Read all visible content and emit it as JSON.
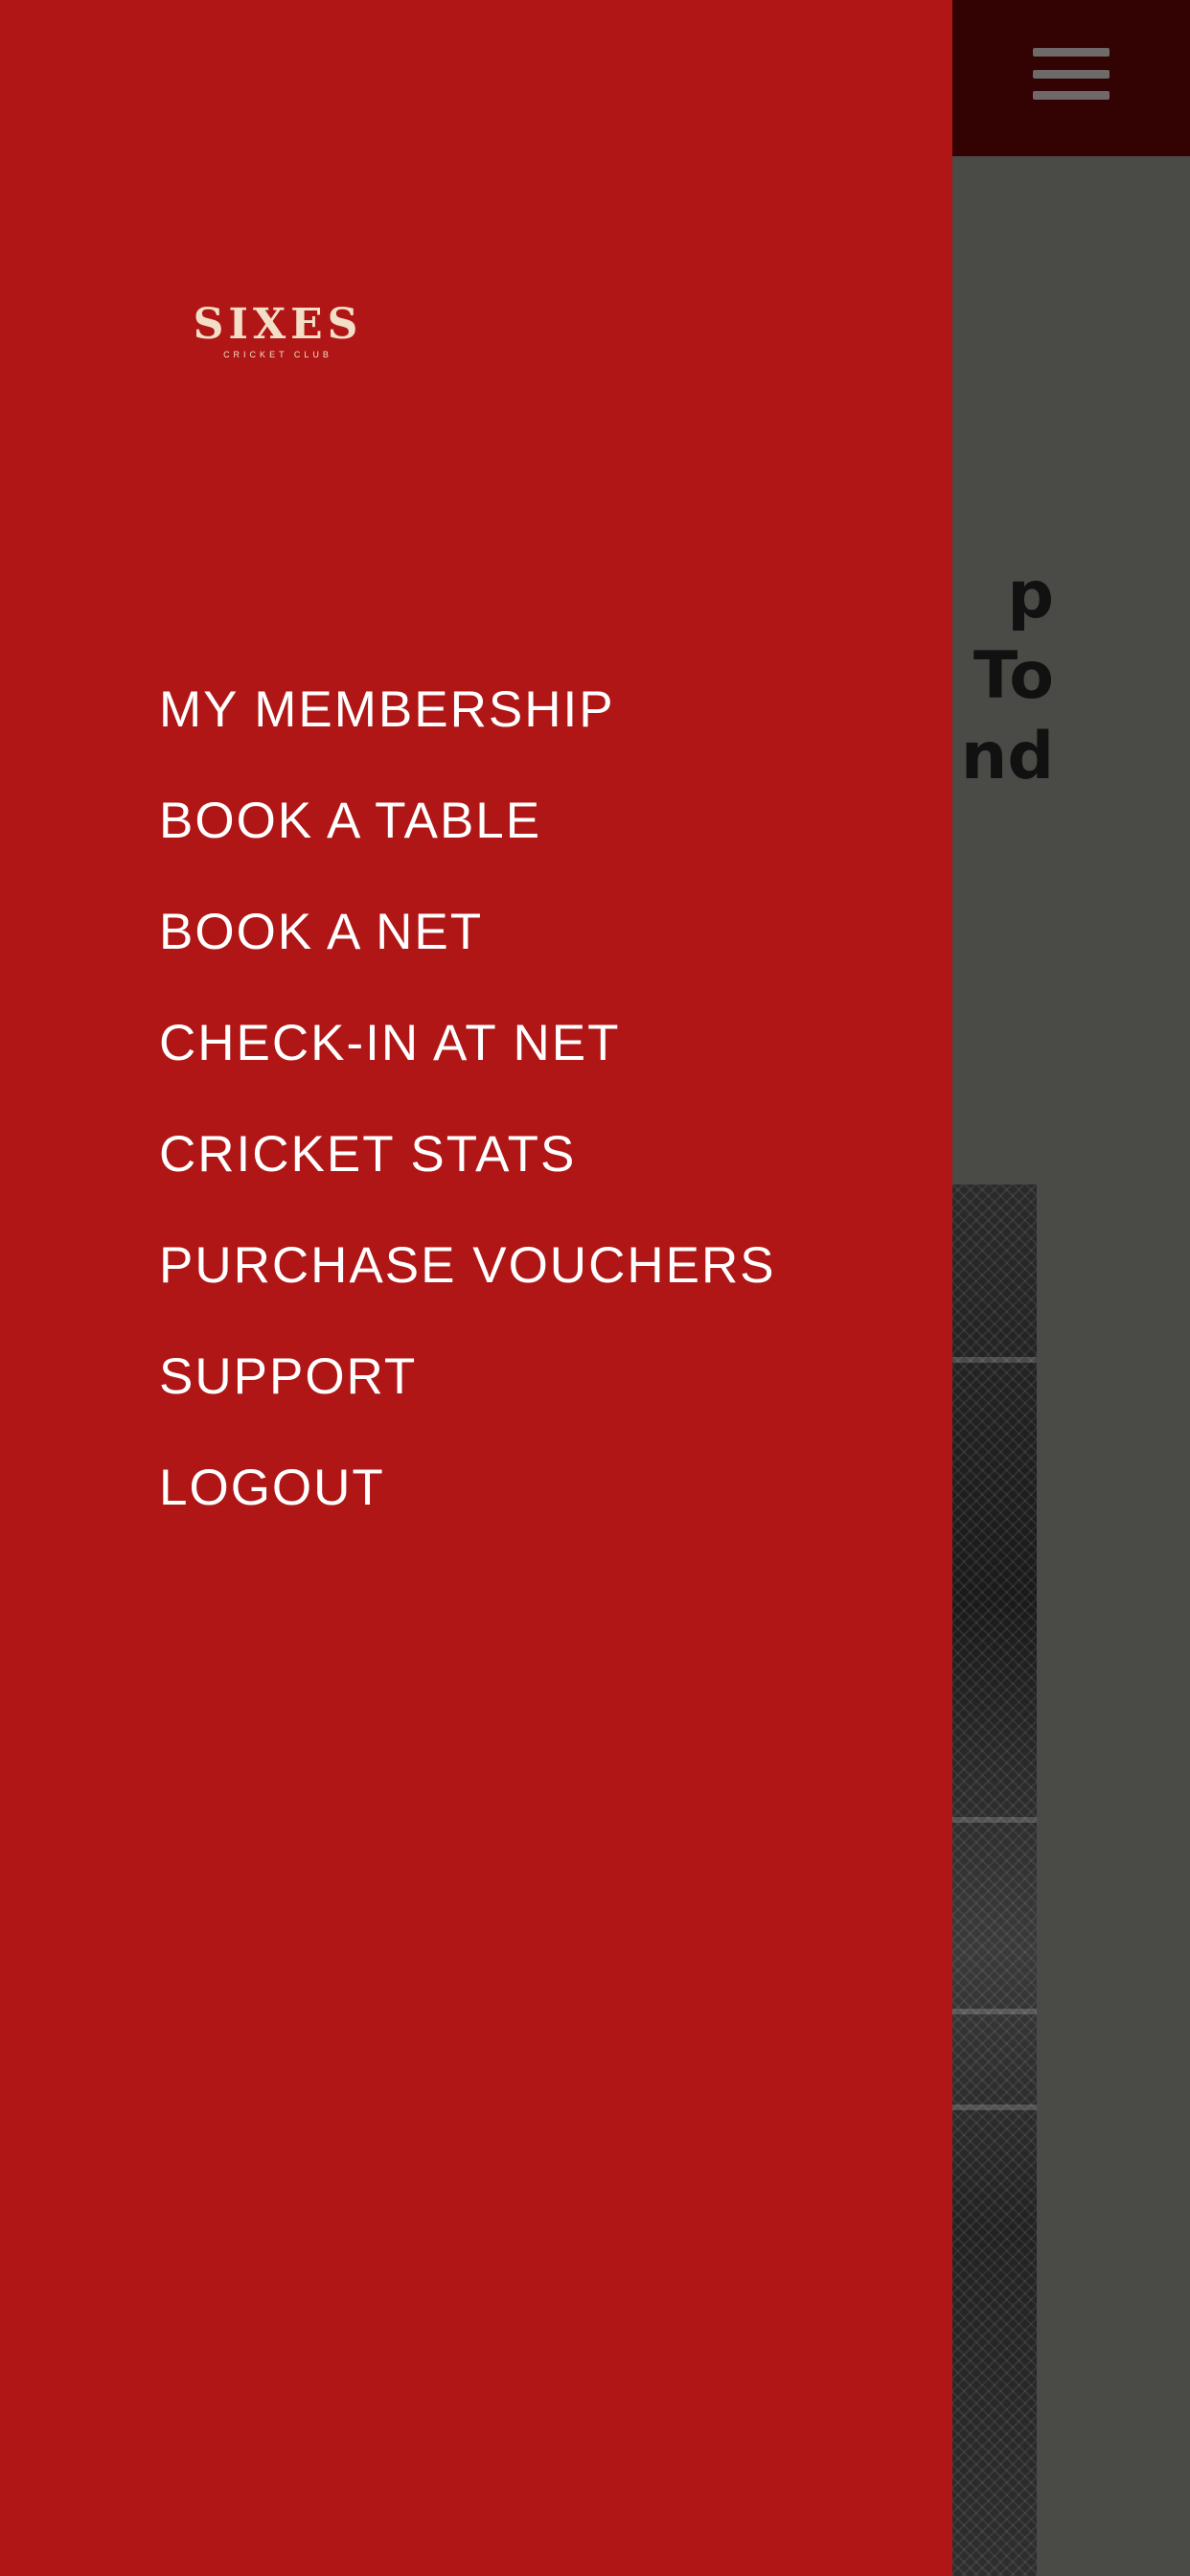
{
  "background": {
    "heading_lines": [
      "p",
      "To",
      "nd"
    ]
  },
  "drawer": {
    "logo": {
      "name": "SIXES",
      "tagline": "CRICKET CLUB"
    },
    "menu": [
      {
        "label": "MY MEMBERSHIP"
      },
      {
        "label": "BOOK A TABLE"
      },
      {
        "label": "BOOK A NET"
      },
      {
        "label": "CHECK-IN AT NET"
      },
      {
        "label": "CRICKET STATS"
      },
      {
        "label": "PURCHASE VOUCHERS"
      },
      {
        "label": "SUPPORT"
      },
      {
        "label": "LOGOUT"
      }
    ]
  },
  "colors": {
    "drawer_bg": "#b01616",
    "overlay_bg": "#4a4a47",
    "header_bg": "#330303",
    "logo_text": "#f3dfc8",
    "menu_text": "#ffffff"
  },
  "icons": {
    "menu": "hamburger-icon"
  }
}
